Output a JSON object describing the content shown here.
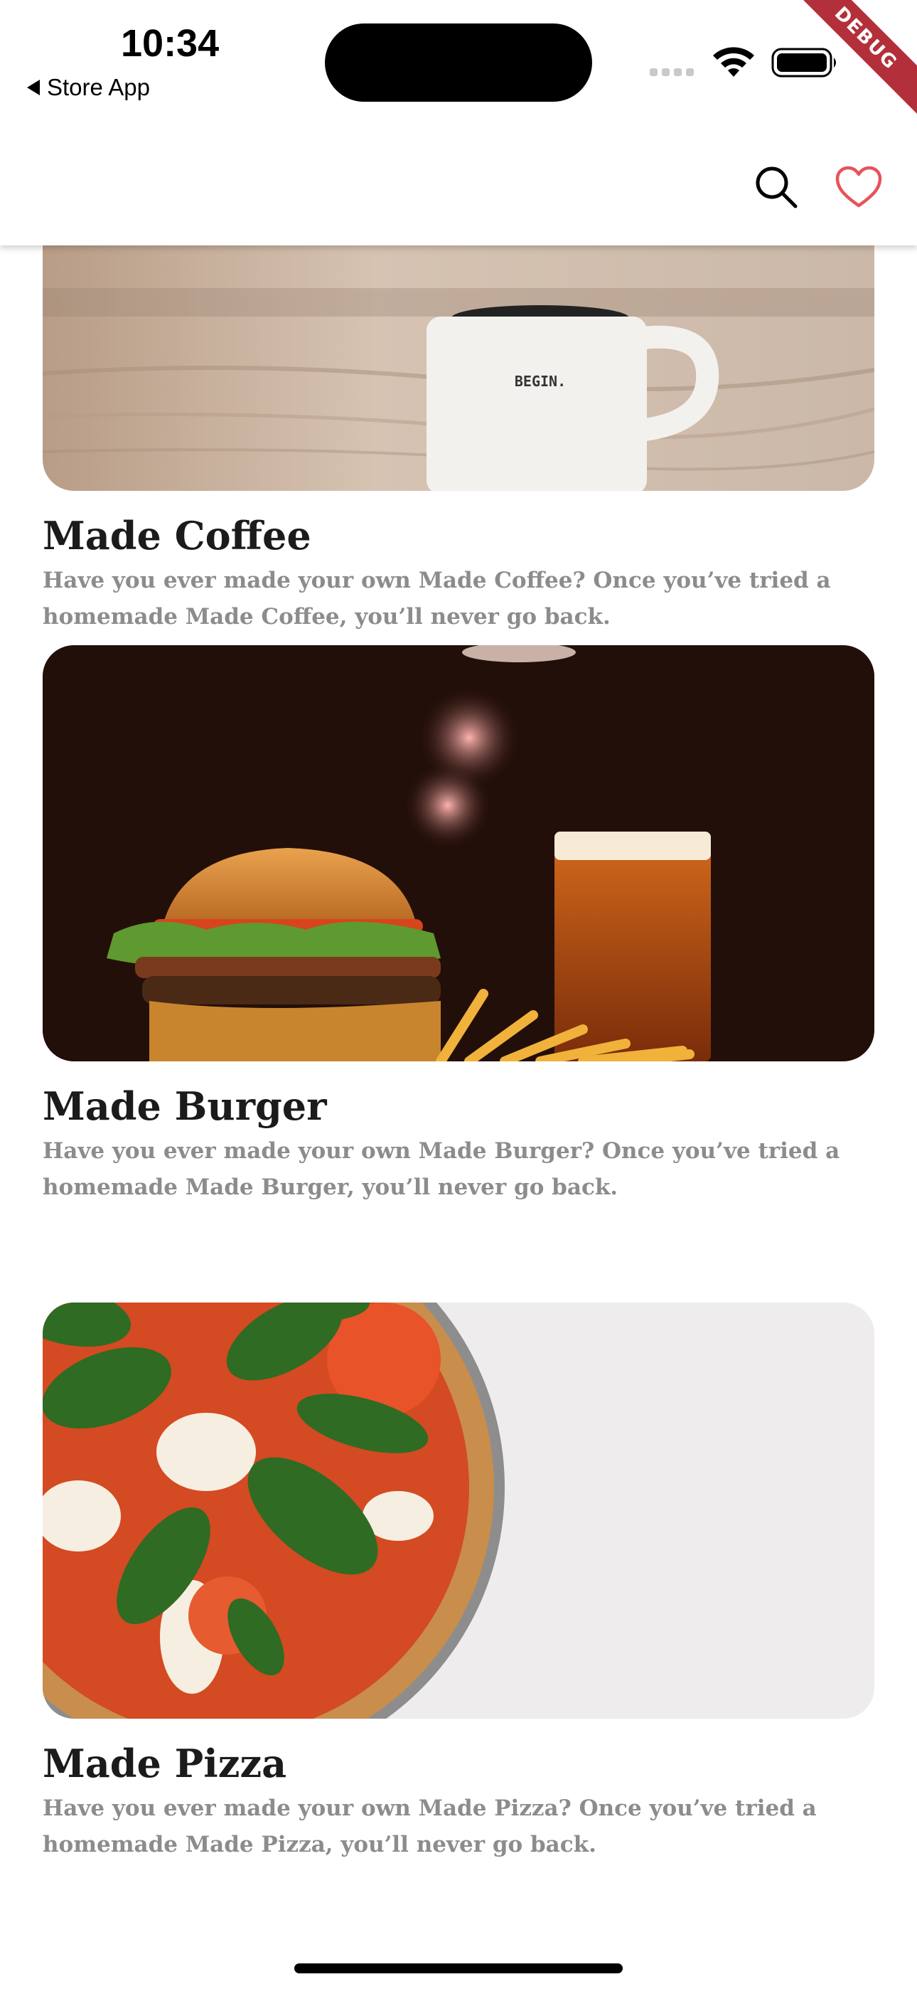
{
  "status_bar": {
    "time": "10:34",
    "back_label": "Store App"
  },
  "debug_label": "DEBUG",
  "app_bar": {
    "search_icon": "search-icon",
    "favorite_icon": "heart-outline-icon",
    "favorite_color": "#e8525a"
  },
  "cards": [
    {
      "title": "Made Coffee",
      "description": "Have you ever made your own Made Coffee? Once you’ve tried a homemade Made Coffee, you’ll never go back.",
      "mug_text": "BEGIN."
    },
    {
      "title": "Made Burger",
      "description": "Have you ever made your own Made Burger? Once you’ve tried a homemade Made Burger, you’ll never go back."
    },
    {
      "title": "Made Pizza",
      "description": "Have you ever made your own Made Pizza? Once you’ve tried a homemade Made Pizza, you’ll never go back."
    }
  ]
}
